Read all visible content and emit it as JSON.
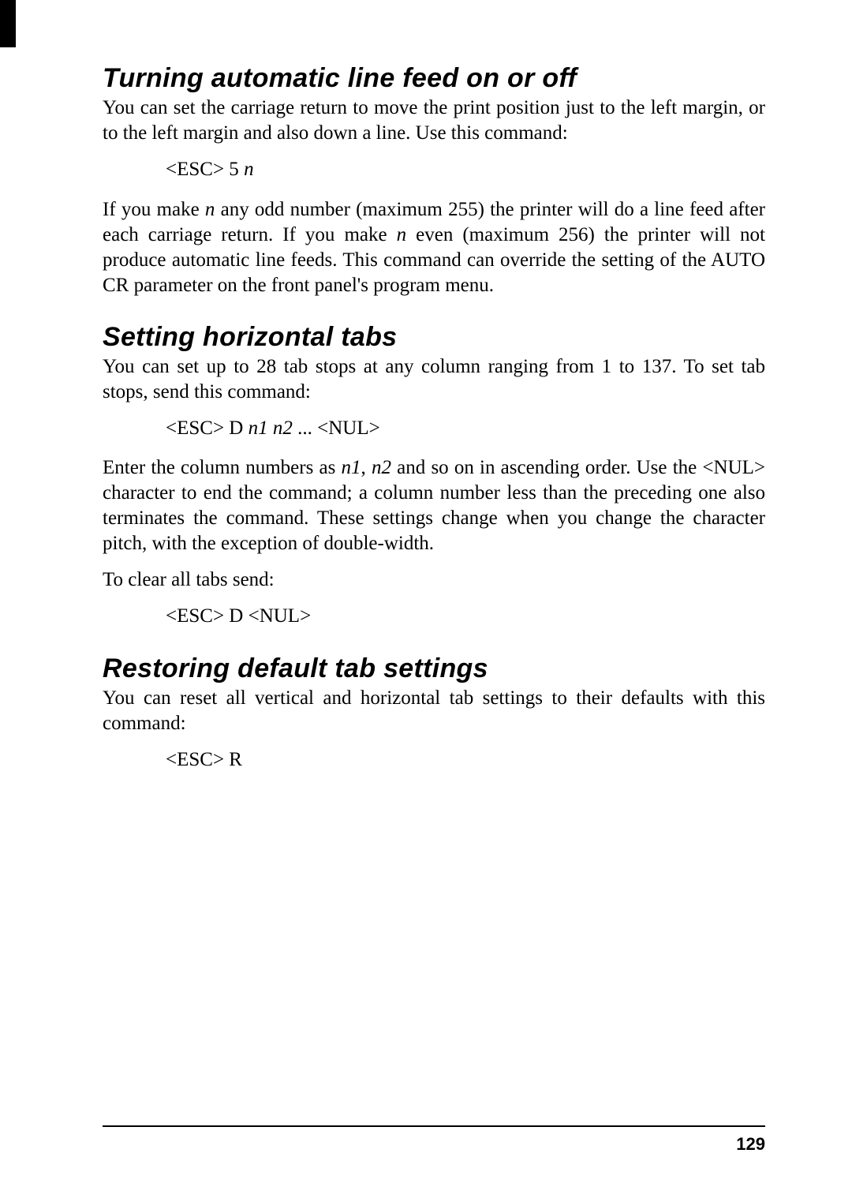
{
  "sections": {
    "s1": {
      "heading": "Turning automatic line feed on or off",
      "p1a": "You can set the carriage return to move the print position just to the left margin, or to the left margin and also down a line. Use this command:",
      "cmd1_pre": "<ESC> 5 ",
      "cmd1_ital": "n",
      "p2a": "If you make ",
      "p2b": "n",
      "p2c": " any odd number (maximum 255) the printer will do a line feed after each carriage return. If you make ",
      "p2d": "n",
      "p2e": " even (maximum 256) the printer will not produce automatic line feeds. This command can override the setting of the AUTO CR parameter on the front panel's program menu."
    },
    "s2": {
      "heading": "Setting horizontal tabs",
      "p1": "You can set up to 28 tab stops at any column ranging from 1 to 137. To set tab stops, send this command:",
      "cmd1_pre": "<ESC> D ",
      "cmd1_ital": "n1 n2",
      "cmd1_post": " ... <NUL>",
      "p2a": "Enter the column numbers as ",
      "p2b": "n1",
      "p2c": ", ",
      "p2d": "n2",
      "p2e": " and so on in ascending order. Use the <NUL> character to end the command; a column number less than the preceding one also terminates the command. These settings change when you change the character pitch, with the exception of double-width.",
      "p3": "To clear all tabs send:",
      "cmd2": "<ESC> D <NUL>"
    },
    "s3": {
      "heading": "Restoring default tab settings",
      "p1": "You can reset all vertical and horizontal tab settings to their defaults with this command:",
      "cmd1": "<ESC> R"
    }
  },
  "page_number": "129"
}
